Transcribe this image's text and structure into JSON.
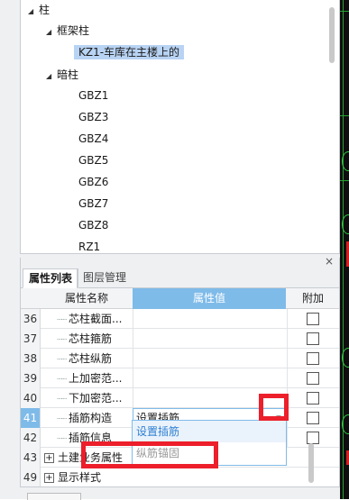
{
  "tree": {
    "root": {
      "label": "柱",
      "expanded": true
    },
    "groups": [
      {
        "label": "框架柱",
        "items": [
          {
            "label": "KZ1-车库在主楼上的",
            "selected": true
          }
        ]
      },
      {
        "label": "暗柱",
        "items": [
          {
            "label": "GBZ1"
          },
          {
            "label": "GBZ3"
          },
          {
            "label": "GBZ4"
          },
          {
            "label": "GBZ5"
          },
          {
            "label": "GBZ6"
          },
          {
            "label": "GBZ7"
          },
          {
            "label": "GBZ8"
          },
          {
            "label": "RZ1"
          }
        ]
      }
    ]
  },
  "panel": {
    "close_label": "×",
    "tabs": [
      {
        "label": "属性列表",
        "active": true
      },
      {
        "label": "图层管理",
        "active": false
      }
    ]
  },
  "grid": {
    "headers": {
      "name": "属性名称",
      "value": "属性值",
      "add": "附加"
    },
    "rows": [
      {
        "num": "36",
        "name": "芯柱截面...",
        "value": "",
        "checkbox": true
      },
      {
        "num": "37",
        "name": "芯柱箍筋",
        "value": "",
        "checkbox": true
      },
      {
        "num": "38",
        "name": "芯柱纵筋",
        "value": "",
        "checkbox": true
      },
      {
        "num": "39",
        "name": "上加密范...",
        "value": "",
        "checkbox": true
      },
      {
        "num": "40",
        "name": "下加密范...",
        "value": "",
        "checkbox": true
      },
      {
        "num": "41",
        "name": "插筋构造",
        "value": "设置插筋",
        "checkbox": true,
        "selected": true
      },
      {
        "num": "42",
        "name": "插筋信息",
        "value": "",
        "checkbox": true
      },
      {
        "num": "43",
        "name": "土建业务属性",
        "value": "",
        "group": true
      },
      {
        "num": "49",
        "name": "显示样式",
        "value": "",
        "group": true
      }
    ]
  },
  "combo": {
    "value": "设置插筋",
    "options": [
      "设置插筋",
      "纵筋锚固"
    ]
  },
  "colors": {
    "selection": "#b8d3f3",
    "header_accent": "#7fbbe9",
    "annotation_red": "#ec1f2b",
    "highlight_text": "#2f7fd1"
  },
  "icons": {
    "expand": "triangle-down-icon",
    "combo_arrow": "triangle-down-icon",
    "group_toggle": "plus-box-icon",
    "close": "close-icon"
  }
}
